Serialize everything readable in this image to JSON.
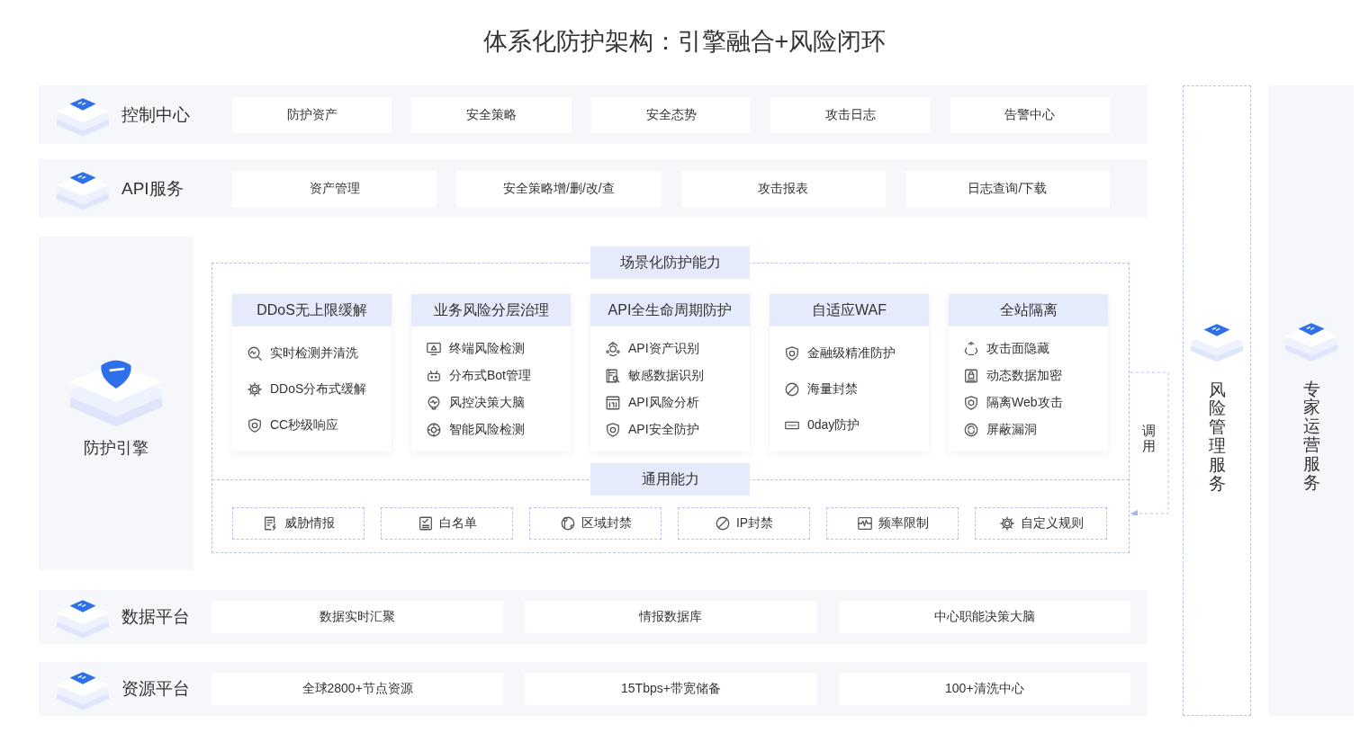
{
  "title": "体系化防护架构：引擎融合+风险闭环",
  "layers_top": [
    {
      "name": "控制中心",
      "items": [
        "防护资产",
        "安全策略",
        "安全态势",
        "攻击日志",
        "告警中心"
      ]
    },
    {
      "name": "API服务",
      "items": [
        "资产管理",
        "安全策略增/删/改/查",
        "攻击报表",
        "日志查询/下载"
      ]
    }
  ],
  "engine": {
    "name": "防护引擎",
    "scenario_title": "场景化防护能力",
    "cards": [
      {
        "title": "DDoS无上限缓解",
        "items": [
          "实时检测并清洗",
          "DDoS分布式缓解",
          "CC秒级响应"
        ]
      },
      {
        "title": "业务风险分层治理",
        "items": [
          "终端风险检测",
          "分布式Bot管理",
          "风控决策大脑",
          "智能风险检测"
        ]
      },
      {
        "title": "API全生命周期防护",
        "items": [
          "API资产识别",
          "敏感数据识别",
          "API风险分析",
          "API安全防护"
        ]
      },
      {
        "title": "自适应WAF",
        "items": [
          "金融级精准防护",
          "海量封禁",
          "0day防护"
        ]
      },
      {
        "title": "全站隔离",
        "items": [
          "攻击面隐藏",
          "动态数据加密",
          "隔离Web攻击",
          "屏蔽漏洞"
        ]
      }
    ],
    "common_title": "通用能力",
    "common_items": [
      "威胁情报",
      "白名单",
      "区域封禁",
      "IP封禁",
      "频率限制",
      "自定义规则"
    ],
    "call_label": "调用"
  },
  "layers_bottom": [
    {
      "name": "数据平台",
      "items": [
        "数据实时汇聚",
        "情报数据库",
        "中心职能决策大脑"
      ]
    },
    {
      "name": "资源平台",
      "items": [
        "全球2800+节点资源",
        "15Tbps+带宽储备",
        "100+清洗中心"
      ]
    }
  ],
  "side_columns": [
    {
      "label": "风险管理服务",
      "kind": "dashed"
    },
    {
      "label": "专家运营服务",
      "kind": "filled"
    }
  ]
}
